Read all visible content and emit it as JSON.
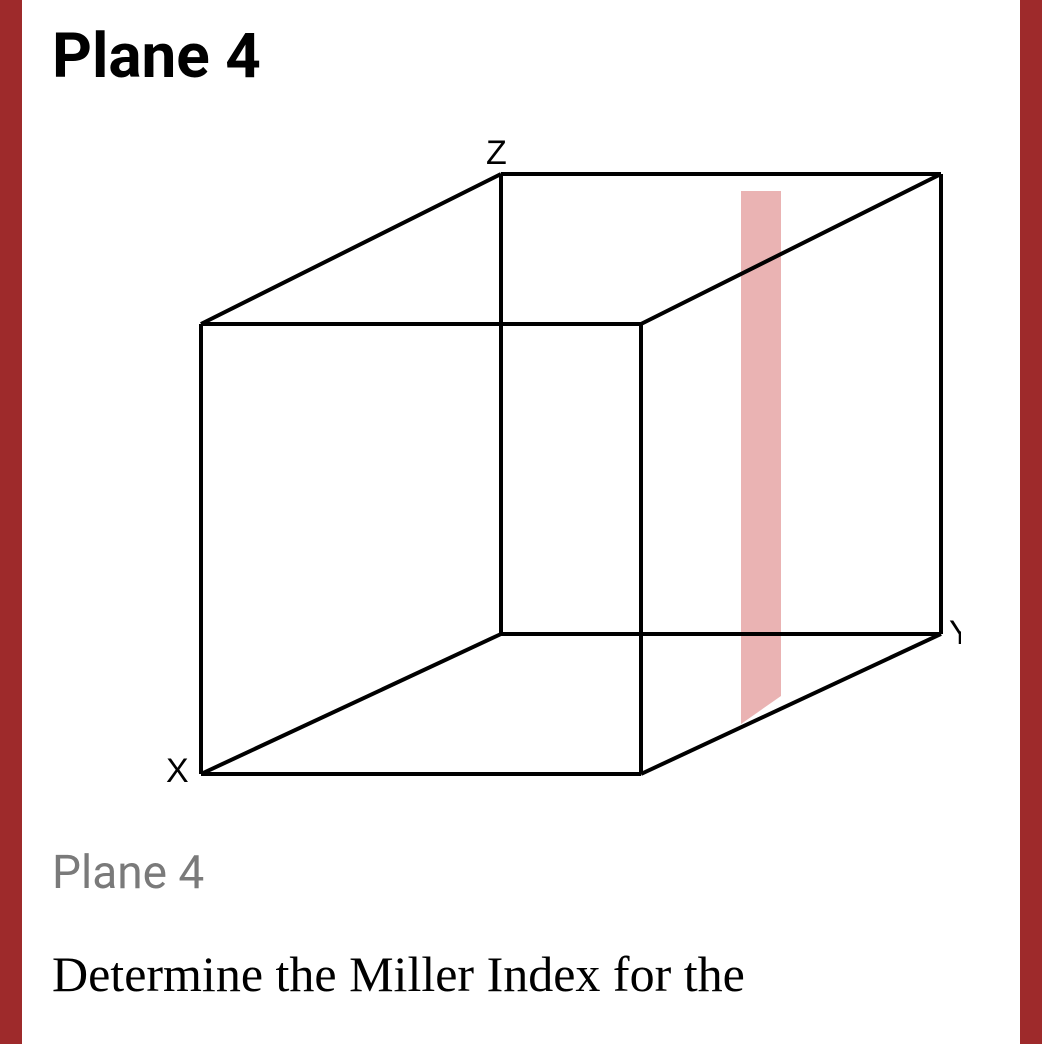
{
  "title": "Plane 4",
  "figure": {
    "caption": "Plane 4",
    "axes": {
      "x": "X",
      "y": "Y",
      "z": "Z"
    },
    "plane_color": "#e6a6a6",
    "plane_opacity": 0.8,
    "edge_color": "#000000",
    "edge_width": 4
  },
  "question_text": "Determine the Miller Index for the"
}
